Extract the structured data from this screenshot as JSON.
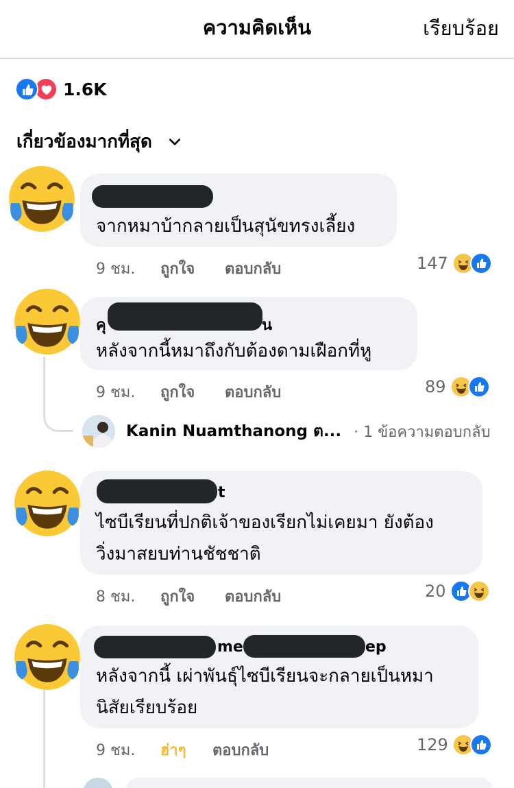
{
  "header": {
    "title": "ความคิดเห็น",
    "done_label": "เรียบร้อย"
  },
  "reactions": {
    "count": "1.6K",
    "icons": [
      "like-icon",
      "love-icon"
    ]
  },
  "sort": {
    "label": "เกี่ยวข้องมากที่สุด",
    "icon": "chevron-down-icon"
  },
  "comments": [
    {
      "name_visible": "",
      "text_lines": [
        "จากหมาบ้ากลายเป็นสุนัขทรงเลี้ยง"
      ],
      "time": "9 ชม.",
      "like_label": "ถูกใจ",
      "reply_label": "ตอบกลับ",
      "reaction_count": "147",
      "reaction_icons": [
        "haha-icon",
        "like-icon"
      ]
    },
    {
      "name_visible_start": "คุ",
      "name_visible_end": "น",
      "text_lines": [
        "หลังจากนี้หมาถึงกับต้องดามเฝือกที่หู"
      ],
      "time": "9 ชม.",
      "like_label": "ถูกใจ",
      "reply_label": "ตอบกลับ",
      "reaction_count": "89",
      "reaction_icons": [
        "haha-icon",
        "like-icon"
      ],
      "reply_preview": {
        "name": "Kanin Nuamthanong ต...",
        "count_text": "· 1 ข้อความตอบกลับ"
      }
    },
    {
      "name_visible_end": "t",
      "text_lines": [
        "ไซบีเรียนที่ปกติเจ้าของเรียกไม่เคยมา ยังต้อง",
        "วิ่งมาสยบท่านชัชชาติ"
      ],
      "time": "8 ชม.",
      "like_label": "ถูกใจ",
      "reply_label": "ตอบกลับ",
      "reaction_count": "20",
      "reaction_icons": [
        "like-icon",
        "haha-icon"
      ]
    },
    {
      "name_visible_mid": "mes",
      "name_visible_end": "ep",
      "text_lines": [
        "หลังจากนี้ เผ่าพันธุ์ไซบีเรียนจะกลายเป็นหมา",
        "นิสัยเรียบร้อย"
      ],
      "time": "9 ชม.",
      "like_label": "ฮ่าๆ",
      "reply_label": "ตอบกลับ",
      "reaction_count": "129",
      "reaction_icons": [
        "haha-icon",
        "like-icon"
      ]
    }
  ],
  "colors": {
    "like_blue": "#1877f2",
    "love_red": "#f33e58",
    "haha_yellow": "#f7b928",
    "bubble_bg": "#f0f2f5",
    "meta_gray": "#65676b"
  }
}
